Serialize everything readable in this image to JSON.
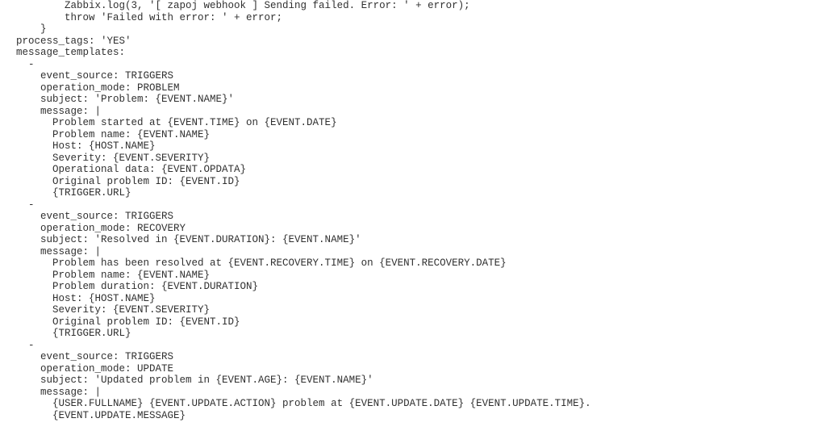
{
  "lines": [
    "        Zabbix.log(3, '[ zapoj webhook ] Sending failed. Error: ' + error);",
    "        throw 'Failed with error: ' + error;",
    "    }",
    "process_tags: 'YES'",
    "message_templates:",
    "  -",
    "    event_source: TRIGGERS",
    "    operation_mode: PROBLEM",
    "    subject: 'Problem: {EVENT.NAME}'",
    "    message: |",
    "      Problem started at {EVENT.TIME} on {EVENT.DATE}",
    "      Problem name: {EVENT.NAME}",
    "      Host: {HOST.NAME}",
    "      Severity: {EVENT.SEVERITY}",
    "      Operational data: {EVENT.OPDATA}",
    "      Original problem ID: {EVENT.ID}",
    "      {TRIGGER.URL}",
    "  -",
    "    event_source: TRIGGERS",
    "    operation_mode: RECOVERY",
    "    subject: 'Resolved in {EVENT.DURATION}: {EVENT.NAME}'",
    "    message: |",
    "      Problem has been resolved at {EVENT.RECOVERY.TIME} on {EVENT.RECOVERY.DATE}",
    "      Problem name: {EVENT.NAME}",
    "      Problem duration: {EVENT.DURATION}",
    "      Host: {HOST.NAME}",
    "      Severity: {EVENT.SEVERITY}",
    "      Original problem ID: {EVENT.ID}",
    "      {TRIGGER.URL}",
    "  -",
    "    event_source: TRIGGERS",
    "    operation_mode: UPDATE",
    "    subject: 'Updated problem in {EVENT.AGE}: {EVENT.NAME}'",
    "    message: |",
    "      {USER.FULLNAME} {EVENT.UPDATE.ACTION} problem at {EVENT.UPDATE.DATE} {EVENT.UPDATE.TIME}.",
    "      {EVENT.UPDATE.MESSAGE}"
  ]
}
